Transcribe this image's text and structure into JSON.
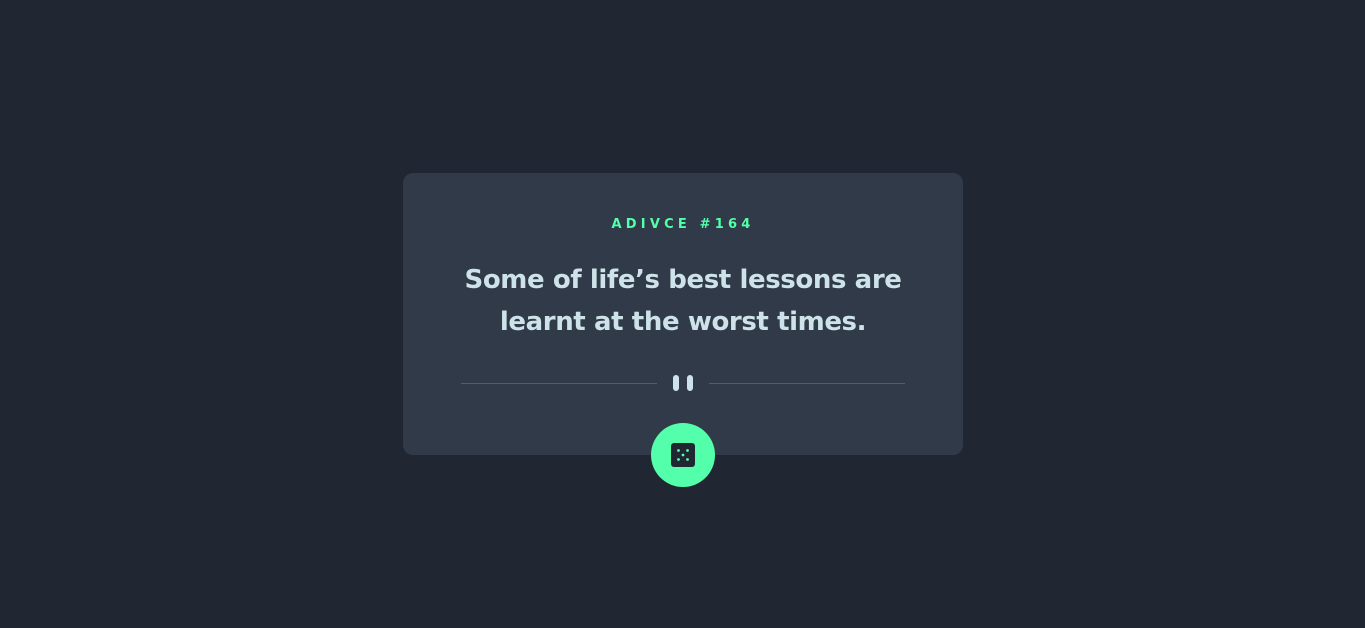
{
  "advice": {
    "label": "ADIVCE #164",
    "quote": "Some of life’s best lessons are learnt at the worst times."
  },
  "icons": {
    "divider": "pause-icon",
    "button": "dice-icon"
  },
  "colors": {
    "background": "#202632",
    "card": "#313A48",
    "accent": "#53FFAA",
    "text": "#CEE3E9",
    "divider": "#4F5D74"
  }
}
